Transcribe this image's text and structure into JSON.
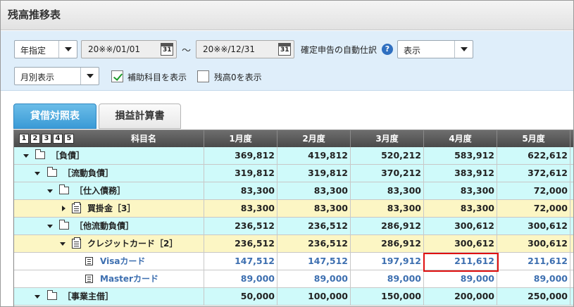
{
  "window": {
    "title": "残高推移表"
  },
  "filters": {
    "period_type": "年指定",
    "date_from": "20※※/01/01",
    "date_to": "20※※/12/31",
    "calendar_icon_text": "31",
    "tilde": "～",
    "auto_journal_label": "確定申告の自動仕訳",
    "auto_journal_value": "表示",
    "display_mode": "月別表示",
    "show_sub_accounts_label": "補助科目を表示",
    "show_sub_accounts_checked": true,
    "show_zero_balance_label": "残高0を表示",
    "show_zero_balance_checked": false
  },
  "tabs": [
    {
      "label": "貸借対照表",
      "active": true
    },
    {
      "label": "損益計算書",
      "active": false
    }
  ],
  "table": {
    "level_buttons": [
      "1",
      "2",
      "3",
      "4",
      "5"
    ],
    "columns": [
      "科目名",
      "1月度",
      "2月度",
      "3月度",
      "4月度",
      "5月度"
    ],
    "rows": [
      {
        "name": "［負債］",
        "values": [
          "369,812",
          "419,812",
          "520,212",
          "583,912",
          "622,612"
        ]
      },
      {
        "name": "［流動負債］",
        "values": [
          "319,812",
          "319,812",
          "370,212",
          "383,912",
          "372,612"
        ]
      },
      {
        "name": "［仕入債務］",
        "values": [
          "83,300",
          "83,300",
          "83,300",
          "83,300",
          "72,000"
        ]
      },
      {
        "name": "買掛金［3］",
        "values": [
          "83,300",
          "83,300",
          "83,300",
          "83,300",
          "72,000"
        ]
      },
      {
        "name": "［他流動負債］",
        "values": [
          "236,512",
          "236,512",
          "286,912",
          "300,612",
          "300,612"
        ]
      },
      {
        "name": "クレジットカード［2］",
        "values": [
          "236,512",
          "236,512",
          "286,912",
          "300,612",
          "300,612"
        ]
      },
      {
        "name": "Visaカード",
        "values": [
          "147,512",
          "147,512",
          "197,912",
          "211,612",
          "211,612"
        ]
      },
      {
        "name": "Masterカード",
        "values": [
          "89,000",
          "89,000",
          "89,000",
          "89,000",
          "89,000"
        ]
      },
      {
        "name": "［事業主借］",
        "values": [
          "50,000",
          "100,000",
          "150,000",
          "200,000",
          "250,000"
        ]
      }
    ]
  },
  "colors": {
    "row_cyan": "#cffafa",
    "row_yellow": "#fcf6c4",
    "link_blue": "#3d6fb0",
    "highlight_red": "#e01010",
    "tab_active": "#3a9ad6"
  }
}
